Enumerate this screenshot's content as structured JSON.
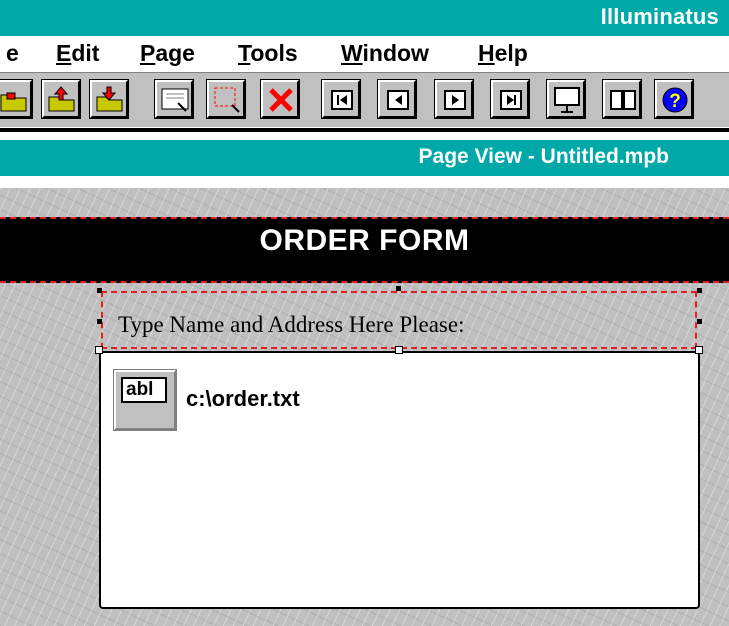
{
  "app": {
    "title": "Illuminatus"
  },
  "menu": {
    "items": [
      {
        "pre": "",
        "ul": "e",
        "post": ""
      },
      {
        "pre": "",
        "ul": "E",
        "post": "dit"
      },
      {
        "pre": "",
        "ul": "P",
        "post": "age"
      },
      {
        "pre": "",
        "ul": "T",
        "post": "ools"
      },
      {
        "pre": "",
        "ul": "W",
        "post": "indow"
      },
      {
        "pre": "",
        "ul": "H",
        "post": "elp"
      }
    ]
  },
  "toolbar": {
    "buttons": [
      "open-folder-icon",
      "import-folder-icon",
      "export-folder-icon",
      "text-frame-icon",
      "select-region-icon",
      "delete-icon",
      "first-page-icon",
      "previous-page-icon",
      "next-page-icon",
      "last-page-icon",
      "presentation-icon",
      "book-icon",
      "help-icon"
    ]
  },
  "view": {
    "title": "Page View - Untitled.mpb"
  },
  "page": {
    "header_title": "ORDER FORM",
    "label": "Type Name and Address Here Please:",
    "textbox_icon_label": "abl",
    "textbox_source": "c:\\order.txt"
  },
  "colors": {
    "titlebar": "#00a8a8",
    "dash": "#e02020",
    "workspace": "#c0c0c0"
  }
}
